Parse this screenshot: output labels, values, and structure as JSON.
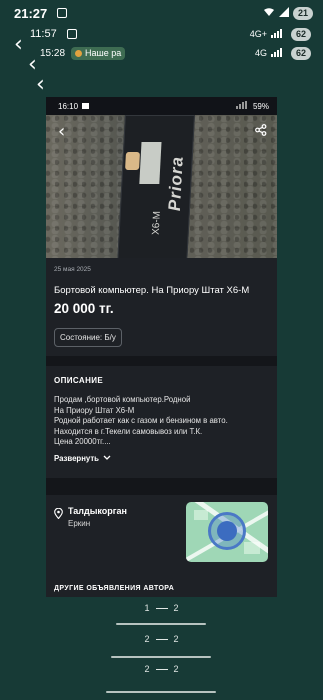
{
  "status_bars": [
    {
      "time": "21:27",
      "battery": "21"
    },
    {
      "time": "11:57",
      "battery": "62",
      "network": "4G+"
    },
    {
      "time": "15:28",
      "chip_label": "Наше ра",
      "battery": "62",
      "network": "4G"
    }
  ],
  "inner_status": {
    "time": "16:10",
    "battery": "59%"
  },
  "listing": {
    "date": "25 мая 2025",
    "title": "Бортовой компьютер. На Приору Штат Х6-М",
    "price": "20 000 тг.",
    "condition": "Состояние: Б/у",
    "device_brand": "Priora",
    "device_model": "X6-M"
  },
  "description": {
    "heading": "ОПИСАНИЕ",
    "text": "Продам ,бортовой компьютер.Родной\nНа Приору Штат Х6-М\nРодной работает как с газом и бензином в авто.\nНаходится в г.Текели самовывоз или Т.К.\nЦена 20000тг....",
    "more_label": "Развернуть"
  },
  "location": {
    "city": "Талдыкорган",
    "district": "Еркин"
  },
  "others_heading": "ДРУГИЕ ОБЪЯВЛЕНИЯ АВТОРА",
  "pager": [
    {
      "left": "1",
      "right": "2"
    },
    {
      "left": "2",
      "right": "2"
    },
    {
      "left": "2",
      "right": "2"
    }
  ]
}
